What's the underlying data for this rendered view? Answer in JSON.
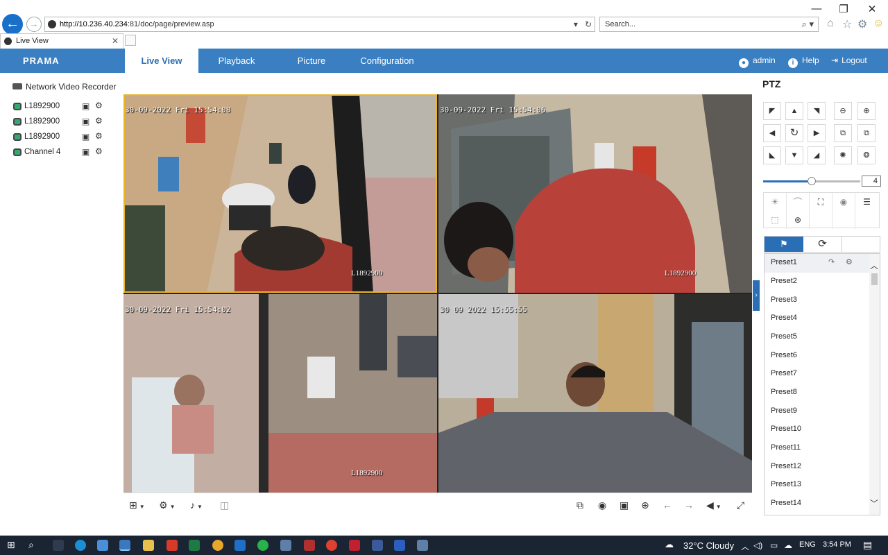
{
  "browser": {
    "address_host": "http://10.236.40.234",
    "address_rest": ":81/doc/page/preview.asp",
    "search_placeholder": "Search...",
    "tab_title": "Live View",
    "win_minimize": "—",
    "win_restore": "❐",
    "win_close": "✕"
  },
  "header": {
    "logo": "PRAMA",
    "tabs": [
      "Live View",
      "Playback",
      "Picture",
      "Configuration"
    ],
    "active_tab": "Live View",
    "user": "admin",
    "help": "Help",
    "logout": "Logout"
  },
  "device_tree": {
    "root": "Network Video Recorder",
    "channels": [
      "L1892900",
      "L1892900",
      "L1892900",
      "Channel 4"
    ]
  },
  "video": {
    "cells": [
      {
        "timestamp": "30-09-2022 Fri 15:54:08",
        "name": "L1892900"
      },
      {
        "timestamp": "30-09-2022 Fri 15:54:06",
        "name": "L1892900"
      },
      {
        "timestamp": "30-09-2022 Fri 15:54:02",
        "name": "L1892900"
      },
      {
        "timestamp": "30 09 2022 15:55:55",
        "name": ""
      }
    ]
  },
  "ptz": {
    "title": "PTZ",
    "speed": 4,
    "speed_max": 7,
    "presets": [
      "Preset1",
      "Preset2",
      "Preset3",
      "Preset4",
      "Preset5",
      "Preset6",
      "Preset7",
      "Preset8",
      "Preset9",
      "Preset10",
      "Preset11",
      "Preset12",
      "Preset13",
      "Preset14"
    ]
  },
  "taskbar": {
    "weather": "32°C  Cloudy",
    "lang": "ENG",
    "time": "3:54 PM"
  }
}
